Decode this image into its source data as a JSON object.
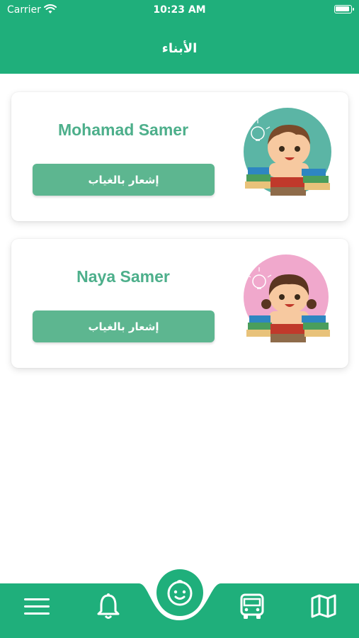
{
  "status_bar": {
    "carrier": "Carrier",
    "time": "10:23 AM"
  },
  "header": {
    "title": "الأبناء"
  },
  "children": [
    {
      "name": "Mohamad Samer",
      "button_label": "إشعار بالغياب",
      "avatar": "boy-reading-icon"
    },
    {
      "name": "Naya Samer",
      "button_label": "إشعار بالغياب",
      "avatar": "girl-reading-icon"
    }
  ],
  "bottom_nav": {
    "items": [
      "menu-icon",
      "bell-icon",
      "child-face-icon",
      "bus-icon",
      "map-icon"
    ],
    "active": "child-face-icon"
  },
  "colors": {
    "primary": "#1FAF7B",
    "button": "#5DB690",
    "name_text": "#4DAF8B",
    "boy_avatar_bg": "#5BB5A5",
    "girl_avatar_bg": "#F0A8CC"
  }
}
